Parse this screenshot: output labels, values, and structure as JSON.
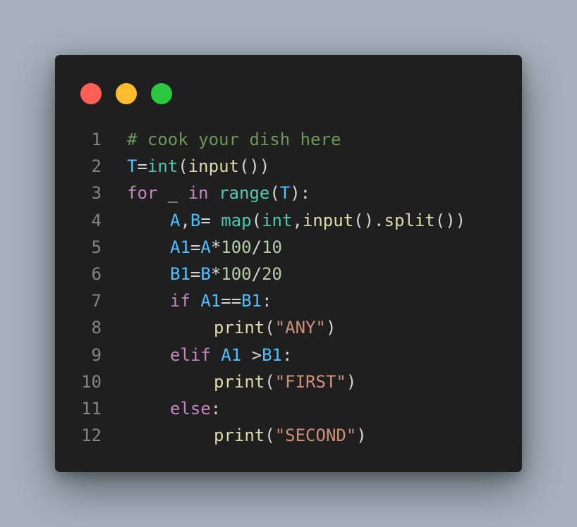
{
  "window": {
    "controls": [
      {
        "name": "close",
        "color": "#ff5f57"
      },
      {
        "name": "minimize",
        "color": "#febc2e"
      },
      {
        "name": "maximize",
        "color": "#28c840"
      }
    ]
  },
  "code": {
    "language": "python",
    "lines": [
      {
        "number": "1",
        "tokens": [
          {
            "text": "# cook your dish here",
            "type": "comment"
          }
        ]
      },
      {
        "number": "2",
        "tokens": [
          {
            "text": "T",
            "type": "var"
          },
          {
            "text": "=",
            "type": "op"
          },
          {
            "text": "int",
            "type": "builtin"
          },
          {
            "text": "(",
            "type": "op"
          },
          {
            "text": "input",
            "type": "function"
          },
          {
            "text": "())",
            "type": "op"
          }
        ]
      },
      {
        "number": "3",
        "tokens": [
          {
            "text": "for",
            "type": "keyword"
          },
          {
            "text": " _ ",
            "type": "op"
          },
          {
            "text": "in",
            "type": "keyword"
          },
          {
            "text": " ",
            "type": "op"
          },
          {
            "text": "range",
            "type": "builtin"
          },
          {
            "text": "(",
            "type": "op"
          },
          {
            "text": "T",
            "type": "var"
          },
          {
            "text": "):",
            "type": "op"
          }
        ]
      },
      {
        "number": "4",
        "indent": 1,
        "tokens": [
          {
            "text": "A",
            "type": "var"
          },
          {
            "text": ",",
            "type": "op"
          },
          {
            "text": "B",
            "type": "var"
          },
          {
            "text": "= ",
            "type": "op"
          },
          {
            "text": "map",
            "type": "builtin"
          },
          {
            "text": "(",
            "type": "op"
          },
          {
            "text": "int",
            "type": "builtin"
          },
          {
            "text": ",",
            "type": "op"
          },
          {
            "text": "input",
            "type": "function"
          },
          {
            "text": "().",
            "type": "op"
          },
          {
            "text": "split",
            "type": "function"
          },
          {
            "text": "())",
            "type": "op"
          }
        ]
      },
      {
        "number": "5",
        "indent": 1,
        "tokens": [
          {
            "text": "A1",
            "type": "var"
          },
          {
            "text": "=",
            "type": "op"
          },
          {
            "text": "A",
            "type": "var"
          },
          {
            "text": "*",
            "type": "op"
          },
          {
            "text": "100",
            "type": "number"
          },
          {
            "text": "/",
            "type": "op"
          },
          {
            "text": "10",
            "type": "number"
          }
        ]
      },
      {
        "number": "6",
        "indent": 1,
        "tokens": [
          {
            "text": "B1",
            "type": "var"
          },
          {
            "text": "=",
            "type": "op"
          },
          {
            "text": "B",
            "type": "var"
          },
          {
            "text": "*",
            "type": "op"
          },
          {
            "text": "100",
            "type": "number"
          },
          {
            "text": "/",
            "type": "op"
          },
          {
            "text": "20",
            "type": "number"
          }
        ]
      },
      {
        "number": "7",
        "indent": 1,
        "tokens": [
          {
            "text": "if",
            "type": "keyword"
          },
          {
            "text": " ",
            "type": "op"
          },
          {
            "text": "A1",
            "type": "var"
          },
          {
            "text": "==",
            "type": "op"
          },
          {
            "text": "B1",
            "type": "var"
          },
          {
            "text": ":",
            "type": "op"
          }
        ]
      },
      {
        "number": "8",
        "indent": 2,
        "tokens": [
          {
            "text": "print",
            "type": "function"
          },
          {
            "text": "(",
            "type": "op"
          },
          {
            "text": "\"ANY\"",
            "type": "string"
          },
          {
            "text": ")",
            "type": "op"
          }
        ]
      },
      {
        "number": "9",
        "indent": 1,
        "tokens": [
          {
            "text": "elif",
            "type": "keyword"
          },
          {
            "text": " ",
            "type": "op"
          },
          {
            "text": "A1",
            "type": "var"
          },
          {
            "text": " >",
            "type": "op"
          },
          {
            "text": "B1",
            "type": "var"
          },
          {
            "text": ":",
            "type": "op"
          }
        ]
      },
      {
        "number": "10",
        "indent": 2,
        "tokens": [
          {
            "text": "print",
            "type": "function"
          },
          {
            "text": "(",
            "type": "op"
          },
          {
            "text": "\"FIRST\"",
            "type": "string"
          },
          {
            "text": ")",
            "type": "op"
          }
        ]
      },
      {
        "number": "11",
        "indent": 1,
        "tokens": [
          {
            "text": "else",
            "type": "keyword"
          },
          {
            "text": ":",
            "type": "op"
          }
        ]
      },
      {
        "number": "12",
        "indent": 2,
        "tokens": [
          {
            "text": "print",
            "type": "function"
          },
          {
            "text": "(",
            "type": "op"
          },
          {
            "text": "\"SECOND\"",
            "type": "string"
          },
          {
            "text": ")",
            "type": "op"
          }
        ]
      }
    ]
  }
}
